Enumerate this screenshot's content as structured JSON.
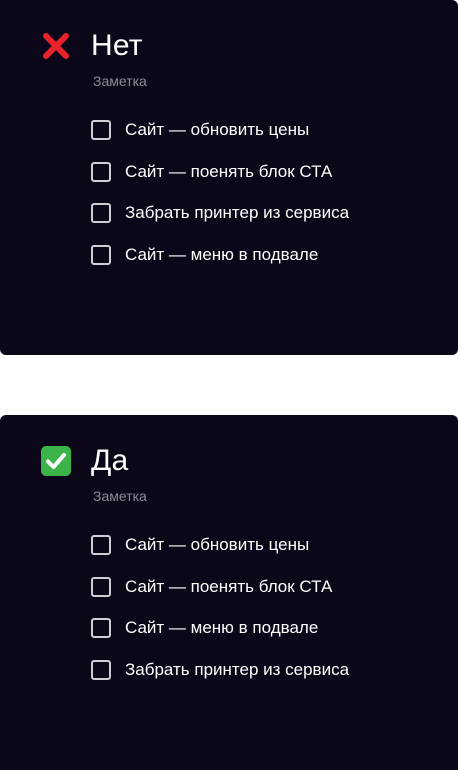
{
  "cards": [
    {
      "status_icon": "cross-mark-icon",
      "title": "Нет",
      "subtitle": "Заметка",
      "tasks": [
        "Сайт — обновить цены",
        "Сайт — поенять блок СТА",
        "Забрать принтер из сервиса",
        "Сайт — меню в подвале"
      ]
    },
    {
      "status_icon": "check-mark-button-icon",
      "title": "Да",
      "subtitle": "Заметка",
      "tasks": [
        "Сайт — обновить цены",
        "Сайт — поенять блок СТА",
        "Сайт — меню в подвале",
        "Забрать принтер из сервиса"
      ]
    }
  ],
  "colors": {
    "card_background": "#0b0618",
    "page_background": "#ffffff",
    "cross_red": "#e8232b",
    "check_green": "#3bb54a",
    "subtitle_gray": "#8e8b98",
    "checkbox_border": "#cfcdd6"
  }
}
